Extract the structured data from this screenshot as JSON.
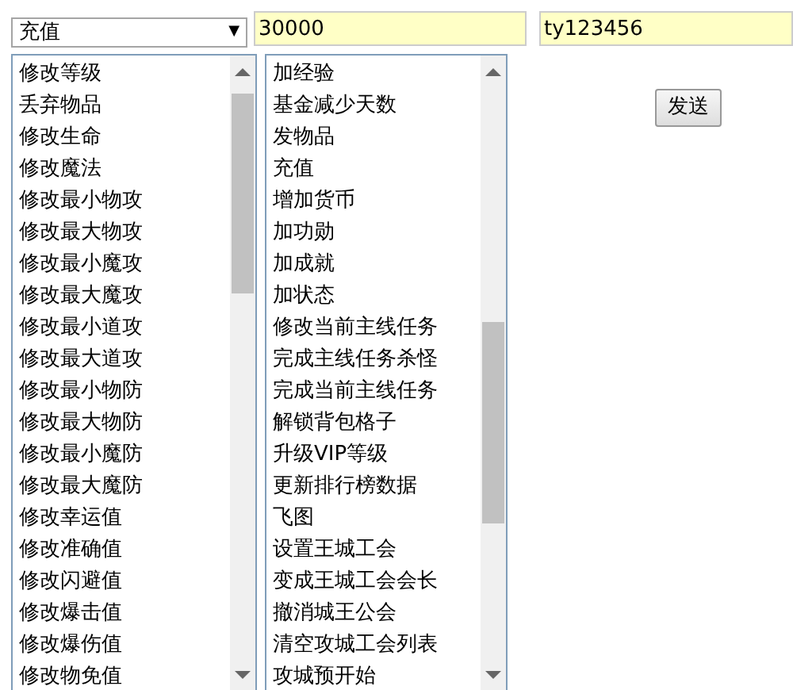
{
  "command_select": {
    "value": "充值",
    "arrow": "▼"
  },
  "amount_field": {
    "value": "30000"
  },
  "account_field": {
    "value": "ty123456"
  },
  "list_1": [
    "修改等级",
    "丢弃物品",
    "修改生命",
    "修改魔法",
    "修改最小物攻",
    "修改最大物攻",
    "修改最小魔攻",
    "修改最大魔攻",
    "修改最小道攻",
    "修改最大道攻",
    "修改最小物防",
    "修改最大物防",
    "修改最小魔防",
    "修改最大魔防",
    "修改幸运值",
    "修改准确值",
    "修改闪避值",
    "修改爆击值",
    "修改爆伤值",
    "修改物免值"
  ],
  "list_2": [
    "加经验",
    "基金减少天数",
    "发物品",
    "充值",
    "增加货币",
    "加功勋",
    "加成就",
    "加状态",
    "修改当前主线任务",
    "完成主线任务杀怪",
    "完成当前主线任务",
    "解锁背包格子",
    "升级VIP等级",
    "更新排行榜数据",
    "飞图",
    "设置王城工会",
    "变成王城工会会长",
    "撤消城王公会",
    "清空攻城工会列表",
    "攻城预开始"
  ],
  "send_button": "发送"
}
